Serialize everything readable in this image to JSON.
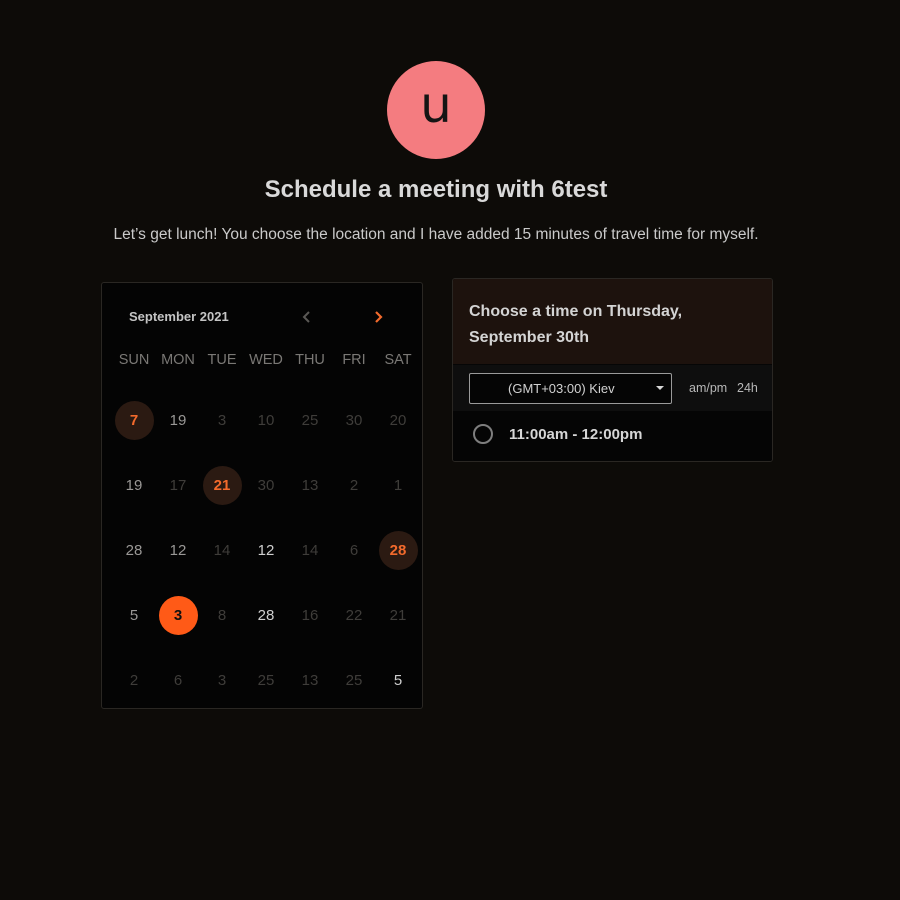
{
  "profile": {
    "initial": "u"
  },
  "header": {
    "title": "Schedule a meeting with 6test",
    "description": "Let’s get lunch! You choose the location and I have added 15 minutes of travel time for myself."
  },
  "calendar": {
    "month_label": "September 2021",
    "prev_icon": "chevron-left-icon",
    "next_icon": "chevron-right-icon",
    "weekdays": [
      "SUN",
      "MON",
      "TUE",
      "WED",
      "THU",
      "FRI",
      "SAT"
    ],
    "weeks": [
      [
        {
          "label": "7",
          "state": "highlight"
        },
        {
          "label": "19",
          "state": "available-dim"
        },
        {
          "label": "3",
          "state": "disabled"
        },
        {
          "label": "10",
          "state": "disabled"
        },
        {
          "label": "25",
          "state": "disabled"
        },
        {
          "label": "30",
          "state": "disabled"
        },
        {
          "label": "20",
          "state": "disabled"
        }
      ],
      [
        {
          "label": "19",
          "state": "available-dim"
        },
        {
          "label": "17",
          "state": "disabled"
        },
        {
          "label": "21",
          "state": "highlight"
        },
        {
          "label": "30",
          "state": "disabled"
        },
        {
          "label": "13",
          "state": "disabled"
        },
        {
          "label": "2",
          "state": "disabled"
        },
        {
          "label": "1",
          "state": "disabled"
        }
      ],
      [
        {
          "label": "28",
          "state": "available-dim"
        },
        {
          "label": "12",
          "state": "available-dim"
        },
        {
          "label": "14",
          "state": "disabled"
        },
        {
          "label": "12",
          "state": "available"
        },
        {
          "label": "14",
          "state": "disabled"
        },
        {
          "label": "6",
          "state": "disabled"
        },
        {
          "label": "28",
          "state": "highlight"
        }
      ],
      [
        {
          "label": "5",
          "state": "available-dim"
        },
        {
          "label": "3",
          "state": "selected"
        },
        {
          "label": "8",
          "state": "disabled"
        },
        {
          "label": "28",
          "state": "available"
        },
        {
          "label": "16",
          "state": "disabled"
        },
        {
          "label": "22",
          "state": "disabled"
        },
        {
          "label": "21",
          "state": "disabled"
        }
      ],
      [
        {
          "label": "2",
          "state": "disabled"
        },
        {
          "label": "6",
          "state": "disabled"
        },
        {
          "label": "3",
          "state": "disabled"
        },
        {
          "label": "25",
          "state": "disabled"
        },
        {
          "label": "13",
          "state": "disabled"
        },
        {
          "label": "25",
          "state": "disabled"
        },
        {
          "label": "5",
          "state": "available"
        }
      ]
    ]
  },
  "times": {
    "heading": "Choose a time on Thursday, September 30th",
    "timezone": "(GMT+03:00) Kiev",
    "format_12h": "am/pm",
    "format_24h": "24h",
    "slots": [
      {
        "label": "11:00am - 12:00pm"
      }
    ]
  },
  "colors": {
    "accent": "#ff5a17",
    "avatar": "#f47c80",
    "background": "#0d0b08"
  }
}
